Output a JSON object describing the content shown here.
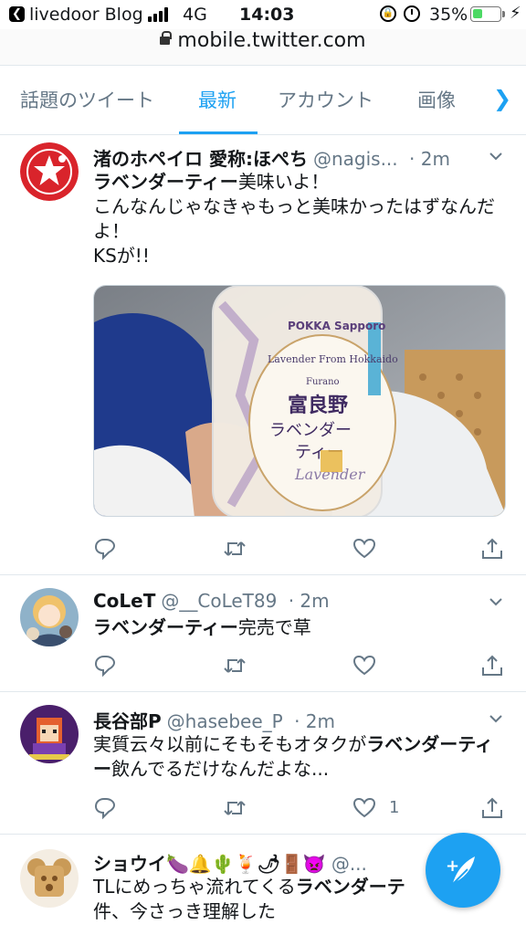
{
  "status_bar": {
    "back_app": "livedoor Blog",
    "network": "4G",
    "time": "14:03",
    "battery_percent": "35%",
    "battery_level": 0.35
  },
  "url_bar": {
    "url": "mobile.twitter.com"
  },
  "tabs": {
    "items": [
      {
        "label": "話題のツイート"
      },
      {
        "label": "最新"
      },
      {
        "label": "アカウント"
      },
      {
        "label": "画像"
      }
    ],
    "active_index": 1,
    "next_icon": "chevron-right-icon"
  },
  "tweets": [
    {
      "name": "渚のホペイロ 愛称:ほぺち",
      "handle": "@nagis...",
      "time": "· 2m",
      "body_line1_hl": "ラベンダーティー",
      "body_line1_rest": "美味いよ！",
      "body_line2": "こんなんじゃなきゃもっと美味かったはずなんだよ！",
      "body_line3": "KSが!!",
      "media": {
        "brand": "POKKA Sapporo",
        "label_en": "Lavender From Hokkaido",
        "label_furano": "Furano",
        "label_jp1": "富良野",
        "label_jp2": "ラベンダー",
        "label_jp3": "ティー",
        "label_script": "Lavender"
      },
      "like_count": ""
    },
    {
      "name": "CoLeT",
      "handle": "@__CoLeT89",
      "time": "· 2m",
      "body_hl": "ラベンダーティー",
      "body_rest": "完売で草",
      "like_count": ""
    },
    {
      "name": "長谷部P",
      "handle": "@hasebee_P",
      "time": "· 2m",
      "body_pre": "実質云々以前にそもそもオタクが",
      "body_hl": "ラベンダーティー",
      "body_post": "飲んでるだけなんだよな...",
      "like_count": "1"
    },
    {
      "name": "ショウイ🍆🔔🌵🍹🌶🚪👿",
      "handle": "@...",
      "body_pre": "TLにめっちゃ流れてくる",
      "body_hl": "ラベンダーテ",
      "body_line2": "件、今さっき理解した",
      "like_count": ""
    }
  ],
  "icons": {
    "reply": "reply-icon",
    "retweet": "retweet-icon",
    "like": "heart-icon",
    "share": "share-icon",
    "compose": "compose-tweet-icon"
  },
  "colors": {
    "accent": "#1da1f2",
    "secondary_text": "#657786",
    "divider": "#e1e8ed"
  }
}
